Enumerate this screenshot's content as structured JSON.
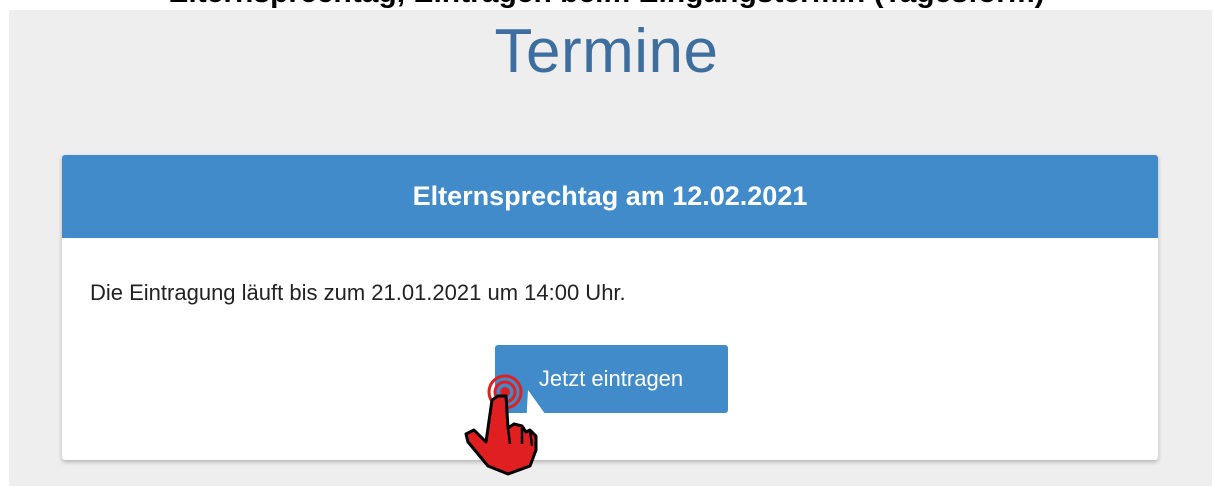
{
  "caption": "Elternsprechtag, Eintragen beim Eingangstermin (Tagesform)",
  "page": {
    "title": "Termine"
  },
  "card": {
    "header": "Elternsprechtag am 12.02.2021",
    "text": "Die Eintragung läuft bis zum 21.01.2021 um 14:00 Uhr.",
    "button_label": "Jetzt eintragen"
  },
  "colors": {
    "accent": "#428bca",
    "title": "#3d6e9e",
    "background": "#eeeeee",
    "pointer": "#e02020"
  },
  "icons": {
    "pointer": "hand-pointer-icon"
  }
}
